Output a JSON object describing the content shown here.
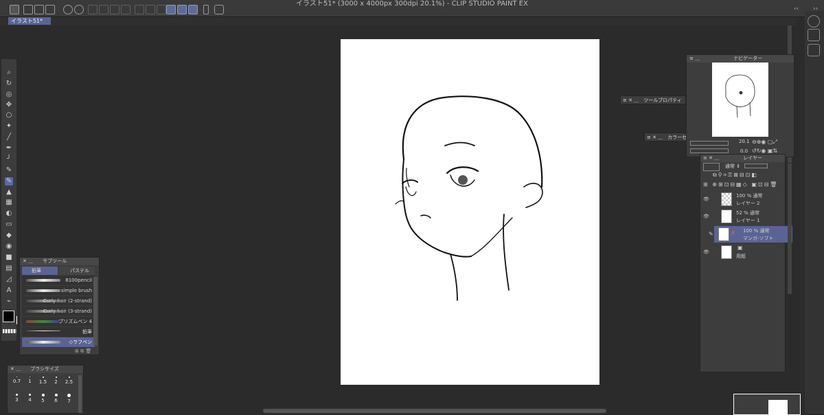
{
  "window": {
    "title": "イラスト51* (3000 x 4000px 300dpi 20.1%) - CLIP STUDIO PAINT EX"
  },
  "tabs": [
    {
      "label": "イラスト51*"
    }
  ],
  "icons": {
    "toolbar": [
      "app-menu-icon",
      "new-icon",
      "open-icon",
      "save-icon",
      "export-icon",
      "undo-icon",
      "redo-icon",
      "clear-icon",
      "fill-icon",
      "transform-icon",
      "deselect-icon",
      "snap-ruler-icon",
      "snap-special-ruler-icon",
      "snap-grid-icon",
      "smartphone-icon",
      "help-icon"
    ],
    "tools": [
      "zoom-icon",
      "rotate-icon",
      "object-select-icon",
      "move-icon",
      "lasso-icon",
      "auto-select-icon",
      "eyedropper-icon",
      "pen-icon",
      "curve-pen-icon",
      "pencil-icon",
      "brush-icon",
      "airbrush-icon",
      "decoration-icon",
      "eraser-icon",
      "blend-icon",
      "fill-icon",
      "gradient-icon",
      "figure-icon",
      "frame-icon",
      "ruler-icon",
      "text-icon",
      "balloon-icon"
    ]
  },
  "subtool_panel": {
    "title": "サブツール",
    "tabs": [
      "鉛筆",
      "パステル"
    ],
    "brushes": [
      "8100pencil",
      "simple brush",
      "Curly hair (2-strand)",
      "Curly hair (3-strand)",
      "プリズムペン 4",
      "鉛筆",
      "◇ラフペン"
    ],
    "selected_brush_index": 6
  },
  "brush_size_panel": {
    "title": "ブラシサイズ",
    "sizes": [
      "0.7",
      "1",
      "1.5",
      "2",
      "2.5",
      "3",
      "4",
      "5",
      "6",
      "7"
    ]
  },
  "navigator": {
    "title": "ナビゲーター",
    "zoom": "20.1",
    "rotation": "0.0"
  },
  "tool_property": {
    "title": "ツールプロパティ"
  },
  "color_panel": {
    "title": "カラーセ"
  },
  "layer_panel": {
    "title": "レイヤー",
    "blend_mode": "通常",
    "layers": [
      {
        "opacity": "100 %",
        "mode": "通常",
        "name": "レイヤー 2"
      },
      {
        "opacity": "52 %",
        "mode": "通常",
        "name": "レイヤー 1"
      },
      {
        "opacity": "100 %",
        "mode": "通常",
        "name": "マンガ-ソフト"
      },
      {
        "opacity": "",
        "mode": "",
        "name": "用紙"
      }
    ]
  },
  "colors": {
    "bg": "#2b2b2b",
    "panel": "#3d3d3d",
    "accent": "#5a6494",
    "canvas": "#ffffff"
  }
}
